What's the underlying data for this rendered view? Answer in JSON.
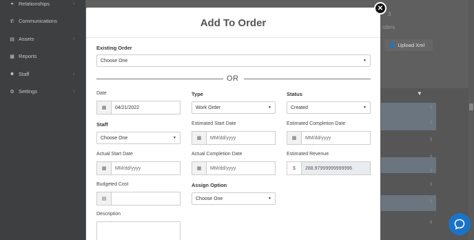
{
  "sidebar": {
    "items": [
      {
        "label": "Relationships",
        "icon": "relationships-icon"
      },
      {
        "label": "Communications",
        "icon": "phone-icon"
      },
      {
        "label": "Assets",
        "icon": "assets-icon"
      },
      {
        "label": "Reports",
        "icon": "reports-icon"
      },
      {
        "label": "Staff",
        "icon": "staff-icon"
      },
      {
        "label": "Settings",
        "icon": "gear-icon"
      }
    ]
  },
  "background": {
    "count": "3",
    "orders_label": "rders",
    "upload_label": "Upload Xml",
    "cells": [
      "$",
      "$",
      "$",
      "$",
      "$",
      "$",
      "$",
      "$",
      "$"
    ]
  },
  "modal": {
    "title": "Add To Order",
    "existing_order_label": "Existing Order",
    "existing_order_value": "Choose One",
    "or_text": "OR",
    "date_label": "Date",
    "date_value": "04/21/2022",
    "type_label": "Type",
    "type_value": "Work Order",
    "status_label": "Status",
    "status_value": "Created",
    "staff_label": "Staff",
    "staff_value": "Choose One",
    "est_start_label": "Estimated Start Date",
    "est_start_placeholder": "MM/dd/yyyy",
    "est_completion_label": "Estimated Completion Date",
    "est_completion_placeholder": "MM/dd/yyyy",
    "actual_start_label": "Actual Start Date",
    "actual_start_placeholder": "MM/dd/yyyy",
    "actual_completion_label": "Actual Completion Date",
    "actual_completion_placeholder": "MM/dd/yyyy",
    "est_revenue_label": "Estimated Revenue",
    "currency_symbol": "$",
    "est_revenue_value": "288.97999999999996",
    "budgeted_cost_label": "Budgeted Cost",
    "assign_option_label": "Assign Option",
    "assign_option_value": "Choose One",
    "description_label": "Description"
  },
  "colors": {
    "chat_button": "#1a73c8",
    "close_button": "#111111"
  }
}
